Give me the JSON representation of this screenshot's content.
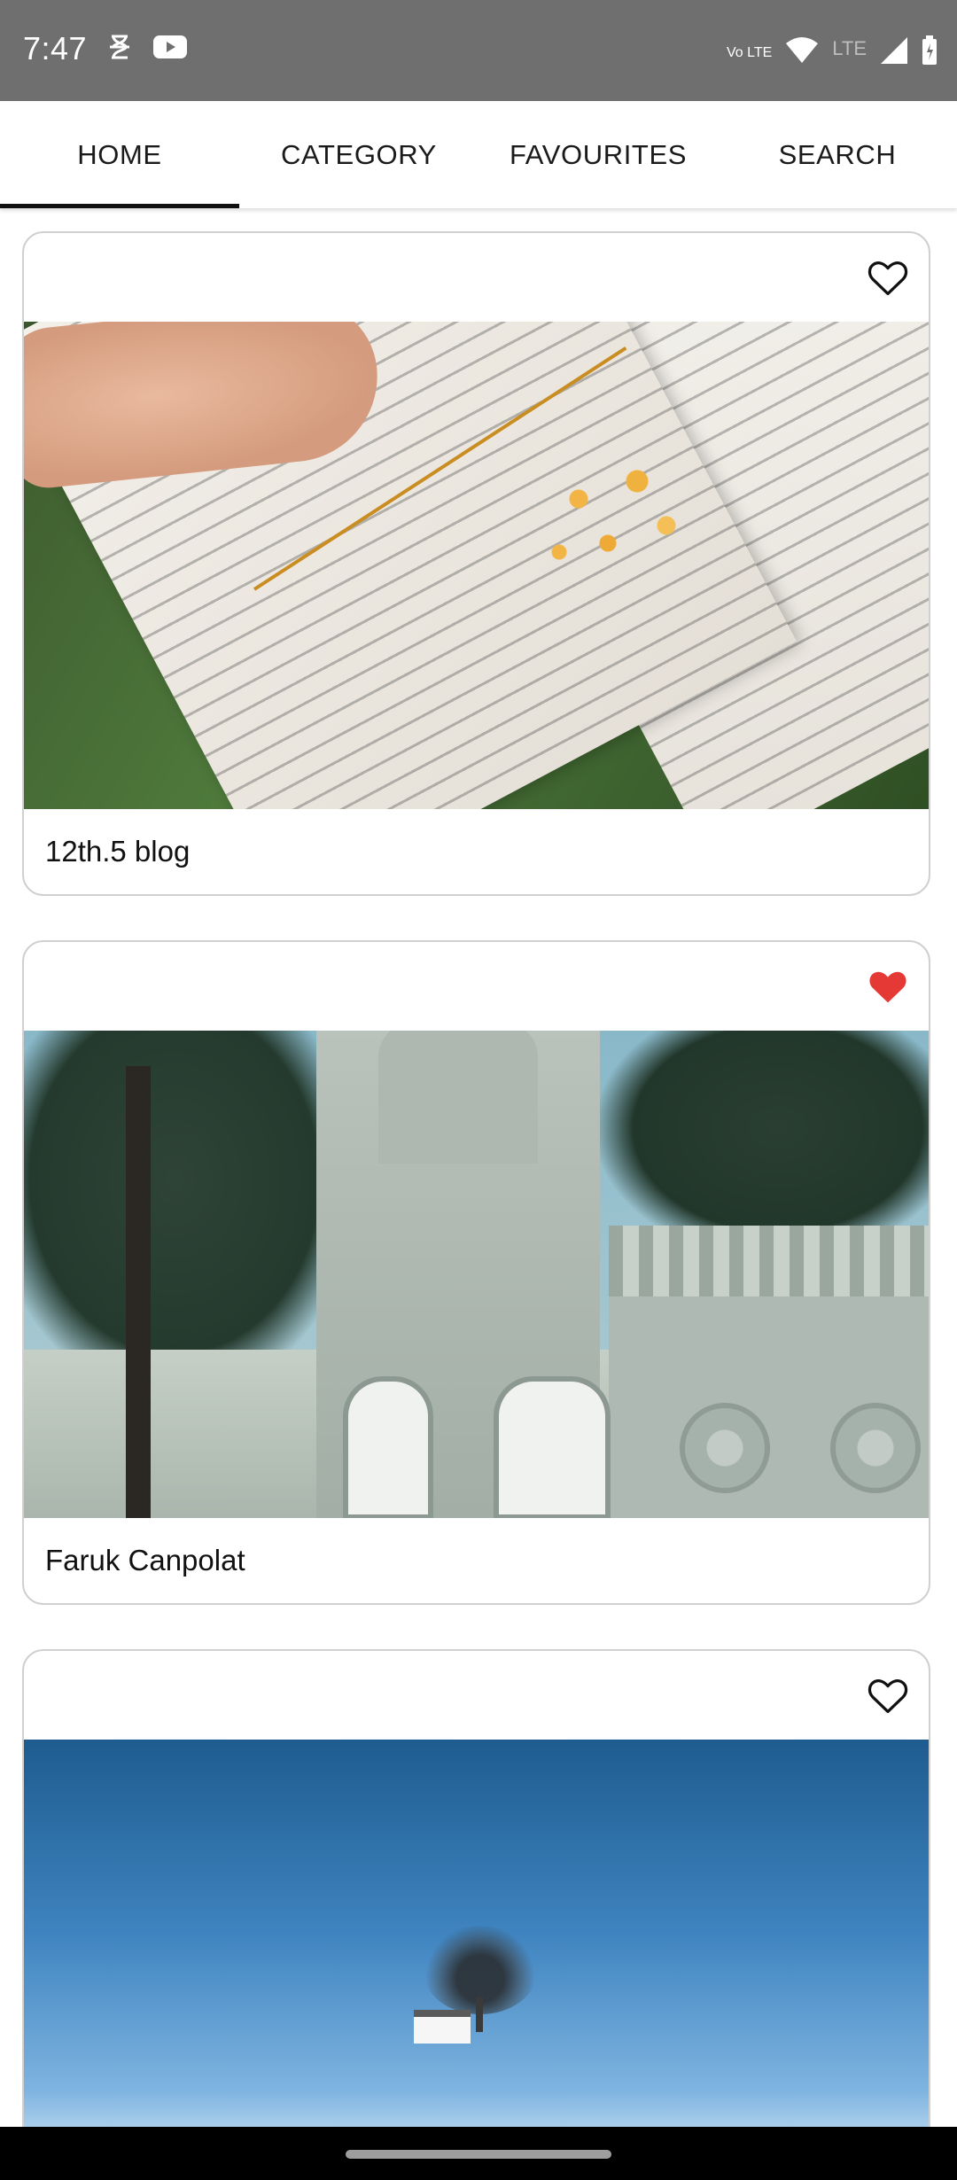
{
  "status_bar": {
    "time": "7:47",
    "left_icons": [
      "notification-icon",
      "youtube-icon"
    ],
    "right_icons": [
      "volte-icon",
      "wifi-icon",
      "lte-signal-icon",
      "battery-icon"
    ],
    "volte_label": "Vo LTE",
    "lte_label": "LTE"
  },
  "tabs": [
    {
      "label": "HOME",
      "selected": true
    },
    {
      "label": "CATEGORY",
      "selected": false
    },
    {
      "label": "FAVOURITES",
      "selected": false
    },
    {
      "label": "SEARCH",
      "selected": false
    }
  ],
  "feed": {
    "cards": [
      {
        "author": "12th.5 blog",
        "favourite": false,
        "photo": "open book with yellow flowers"
      },
      {
        "author": "Faruk Canpolat",
        "favourite": true,
        "photo": "ornate palace with trees"
      },
      {
        "author": "",
        "favourite": false,
        "photo": "tree and small house on snowy field"
      }
    ]
  },
  "colors": {
    "status_bar": "#6f6f6f",
    "favourite_active": "#e53935",
    "tab_indicator": "#111111",
    "card_border": "#d0d0d0"
  }
}
